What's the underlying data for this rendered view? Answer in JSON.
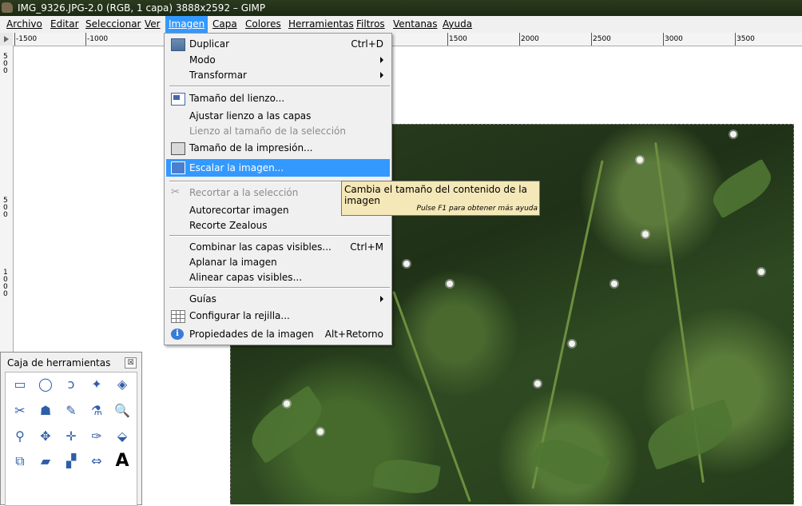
{
  "window": {
    "title": "IMG_9326.JPG-2.0 (RGB, 1 capa) 3888x2592 – GIMP"
  },
  "menubar": {
    "items": [
      "Archivo",
      "Editar",
      "Seleccionar",
      "Ver",
      "Imagen",
      "Capa",
      "Colores",
      "Herramientas",
      "Filtros",
      "Ventanas",
      "Ayuda"
    ],
    "active": "Imagen"
  },
  "rulers": {
    "h_ticks": [
      "-1500",
      "-1000",
      "1500",
      "2000",
      "2500",
      "3000",
      "3500"
    ],
    "v_ticks": [
      "500",
      "500",
      "1000"
    ]
  },
  "image_menu": {
    "items": [
      {
        "label": "Duplicar",
        "shortcut": "Ctrl+D",
        "icon": "duplicate-icon"
      },
      {
        "label": "Modo",
        "submenu": true
      },
      {
        "label": "Transformar",
        "submenu": true
      },
      {
        "label": "Tamaño del lienzo...",
        "icon": "canvas-size-icon"
      },
      {
        "label": "Ajustar lienzo a las capas"
      },
      {
        "label": "Lienzo al tamaño de la selección",
        "disabled": true
      },
      {
        "label": "Tamaño de la impresión...",
        "icon": "print-size-icon"
      },
      {
        "label": "Escalar la imagen...",
        "icon": "scale-image-icon",
        "highlighted": true
      },
      {
        "label": "Recortar a la selección",
        "icon": "crop-icon",
        "disabled": true
      },
      {
        "label": "Autorecortar imagen"
      },
      {
        "label": "Recorte Zealous"
      },
      {
        "label": "Combinar las capas visibles...",
        "shortcut": "Ctrl+M"
      },
      {
        "label": "Aplanar la imagen"
      },
      {
        "label": "Alinear capas visibles..."
      },
      {
        "label": "Guías",
        "submenu": true
      },
      {
        "label": "Configurar la rejilla...",
        "icon": "grid-icon"
      },
      {
        "label": "Propiedades de la imagen",
        "shortcut": "Alt+Retorno",
        "icon": "info-icon"
      }
    ]
  },
  "tooltip": {
    "text": "Cambia el tamaño del contenido de la imagen",
    "help": "Pulse F1 para obtener más ayuda"
  },
  "toolbox": {
    "title": "Caja de herramientas",
    "close_glyph": "☒",
    "tools": [
      "▭",
      "◯",
      "ↄ",
      "✦",
      "◈",
      "✂",
      "☗",
      "✎",
      "⚗",
      "🔍",
      "⚲",
      "✥",
      "✛",
      "✑",
      "⬙",
      "⧉",
      "▰",
      "▞",
      "⇔",
      "A"
    ]
  }
}
